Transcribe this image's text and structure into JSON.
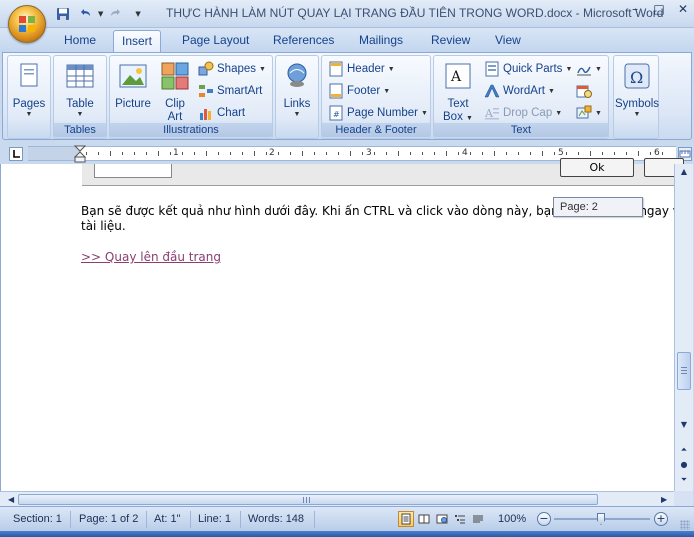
{
  "window": {
    "title": "THỰC HÀNH LÀM NÚT QUAY LẠI TRANG ĐẦU TIÊN TRONG WORD.docx - Microsoft Word",
    "controls": [
      "–",
      "□",
      "✕"
    ]
  },
  "qat": {
    "items": [
      "save-icon",
      "undo-icon",
      "redo-icon",
      "customize-caret"
    ]
  },
  "tabs": [
    {
      "label": "Home"
    },
    {
      "label": "Insert"
    },
    {
      "label": "Page Layout"
    },
    {
      "label": "References"
    },
    {
      "label": "Mailings"
    },
    {
      "label": "Review"
    },
    {
      "label": "View"
    }
  ],
  "active_tab": "Insert",
  "ribbon": {
    "pages": {
      "label": "Pages"
    },
    "tables": {
      "label": "Table",
      "group": "Tables"
    },
    "illustrations": {
      "group": "Illustrations",
      "picture": "Picture",
      "clipart_1": "Clip",
      "clipart_2": "Art",
      "shapes": "Shapes",
      "smartart": "SmartArt",
      "chart": "Chart"
    },
    "links": {
      "label": "Links"
    },
    "header_footer": {
      "group": "Header & Footer",
      "header": "Header",
      "footer": "Footer",
      "page_number": "Page Number"
    },
    "text": {
      "group": "Text",
      "textbox_1": "Text",
      "textbox_2": "Box",
      "quick_parts": "Quick Parts",
      "wordart": "WordArt",
      "drop_cap": "Drop Cap"
    },
    "symbols": {
      "label": "Symbols"
    }
  },
  "ruler": {
    "numbers": [
      "1",
      "2",
      "3",
      "4",
      "5",
      "6"
    ]
  },
  "document": {
    "dialog_ok": "Ok",
    "paragraph_line1": "Bạn sẽ được kết quả như hình dưới đây. Khi ấn CTRL và click vào dòng này, bạn sẽ được đưa ngay về",
    "paragraph_line2": "tài liệu.",
    "link_text": ">> Quay lên đầu trang",
    "page_tooltip": "Page: 2"
  },
  "statusbar": {
    "section": "Section: 1",
    "page": "Page: 1 of 2",
    "at": "At: 1\"",
    "line": "Line: 1",
    "words": "Words: 148",
    "zoom": "100%"
  },
  "colors": {
    "ribbon_text": "#15428b",
    "link": "#8a3e72",
    "active_view": "#ffc75a"
  }
}
